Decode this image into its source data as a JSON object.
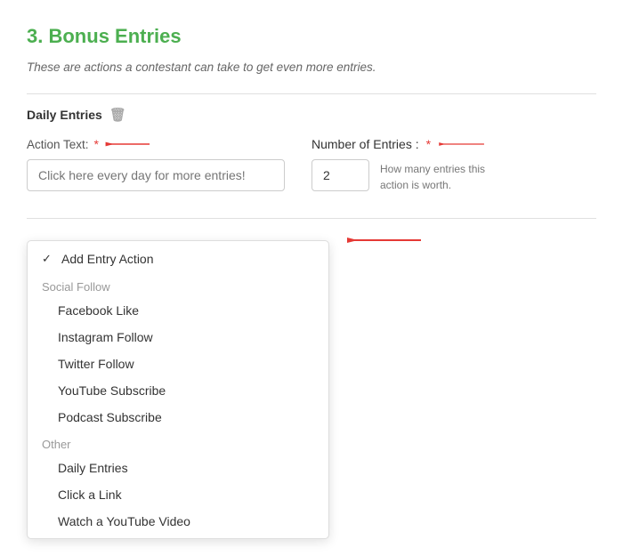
{
  "section": {
    "step_number": "3.",
    "title": "Bonus Entries",
    "subtitle": "These are actions a contestant can take to get even more entries.",
    "daily_entries_label": "Daily Entries",
    "action_text_label": "Action Text:",
    "action_text_placeholder": "Click here every day for more entries!",
    "number_of_entries_label": "Number of Entries :",
    "number_of_entries_value": "2",
    "entries_hint": "How many entries this action is worth."
  },
  "dropdown": {
    "selected_label": "Add Entry Action",
    "groups": [
      {
        "label": "Social Follow",
        "items": [
          "Facebook Like",
          "Instagram Follow",
          "Twitter Follow",
          "YouTube Subscribe",
          "Podcast Subscribe"
        ]
      },
      {
        "label": "Other",
        "items": [
          "Daily Entries",
          "Click a Link",
          "Watch a YouTube Video"
        ]
      }
    ]
  },
  "icons": {
    "trash": "🗑",
    "checkmark": "✓",
    "chevron_down": "›"
  }
}
